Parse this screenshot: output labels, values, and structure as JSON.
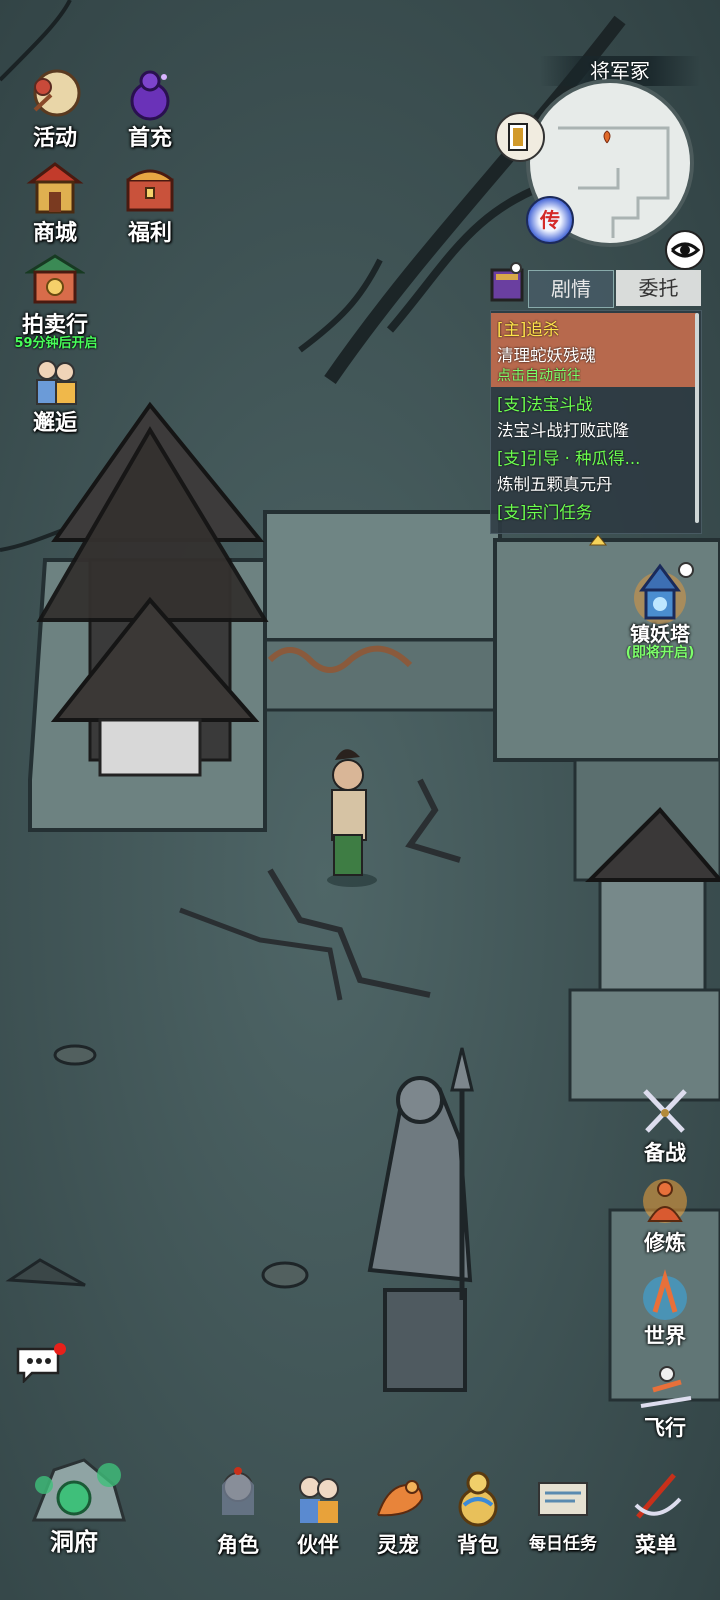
{
  "top_left_menu": {
    "activity_label": "活动",
    "first_recharge_label": "首充",
    "shop_label": "商城",
    "welfare_label": "福利",
    "auction_label": "拍卖行",
    "auction_timer": "59分钟后开启",
    "encounter_label": "邂逅"
  },
  "minimap": {
    "location_name": "将军冢",
    "teleport_label": "传"
  },
  "quest_tracker": {
    "tabs": [
      "剧情",
      "委托"
    ],
    "quests": [
      {
        "tag": "[主]追杀",
        "desc": "清理蛇妖残魂",
        "status": "点击自动前往"
      },
      {
        "tag": "[支]法宝斗战",
        "desc": "法宝斗战打败武隆"
      },
      {
        "tag": "[支]引导 · 种瓜得...",
        "desc": "炼制五颗真元丹"
      },
      {
        "tag": "[支]宗门任务"
      }
    ]
  },
  "tower": {
    "label": "镇妖塔",
    "sub": "(即将开启)"
  },
  "right_menu": [
    "备战",
    "修炼",
    "世界",
    "飞行"
  ],
  "bottom_bar": {
    "cave_label": "洞府",
    "items": [
      "角色",
      "伙伴",
      "灵宠",
      "背包",
      "每日任务",
      "菜单"
    ]
  },
  "colors": {
    "highlight_quest_bg": "#b7694d",
    "quest_panel_bg": "#2d3a42",
    "timer_green": "#48ff5a"
  }
}
